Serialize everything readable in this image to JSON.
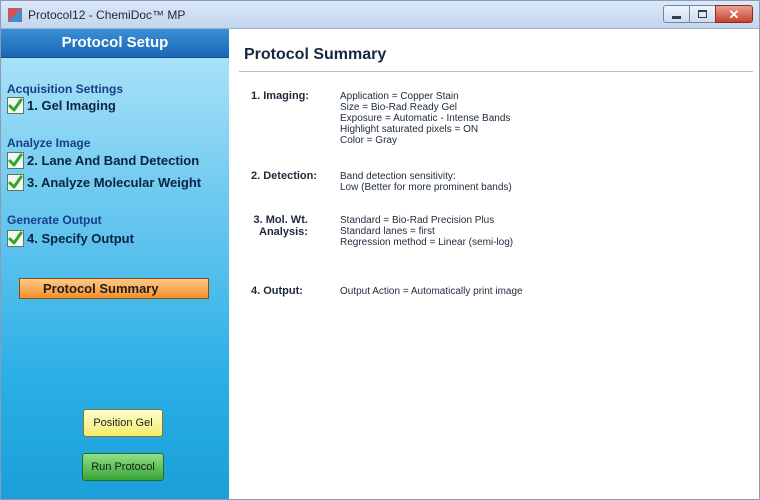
{
  "window": {
    "title": "Protocol12 - ChemiDoc™ MP"
  },
  "sidebar": {
    "header": "Protocol Setup",
    "groups": [
      {
        "label": "Acquisition Settings",
        "steps": [
          {
            "label": "1. Gel Imaging",
            "checked": true
          }
        ]
      },
      {
        "label": "Analyze Image",
        "steps": [
          {
            "label": "2. Lane And Band Detection",
            "checked": true
          },
          {
            "label": "3. Analyze Molecular Weight",
            "checked": true
          }
        ]
      },
      {
        "label": "Generate Output",
        "steps": [
          {
            "label": "4. Specify Output",
            "checked": true
          }
        ]
      }
    ],
    "summary_tab": "Protocol Summary",
    "position_gel_button": "Position Gel",
    "run_protocol_button": "Run Protocol"
  },
  "main": {
    "title": "Protocol Summary",
    "sections": [
      {
        "label": "1. Imaging:",
        "lines": [
          "Application = Copper Stain",
          "Size = Bio-Rad Ready Gel",
          "Exposure = Automatic - Intense Bands",
          "Highlight saturated pixels = ON",
          "Color = Gray"
        ]
      },
      {
        "label": "2. Detection:",
        "lines": [
          "Band detection sensitivity:",
          "Low (Better for more prominent bands)"
        ]
      },
      {
        "label_line1": "3. Mol. Wt.",
        "label_line2": "Analysis:",
        "lines": [
          "Standard = Bio-Rad Precision Plus",
          "Standard lanes = first",
          "Regression method = Linear (semi-log)"
        ]
      },
      {
        "label": "4. Output:",
        "lines": [
          "Output Action = Automatically print image"
        ]
      }
    ]
  },
  "colors": {
    "sidebar_header": "#1a67b5",
    "checkmark": "#2fa52a",
    "summary_tab": "#f68f2a",
    "position_gel": "#f2ec6a",
    "run_protocol": "#3aa437"
  }
}
